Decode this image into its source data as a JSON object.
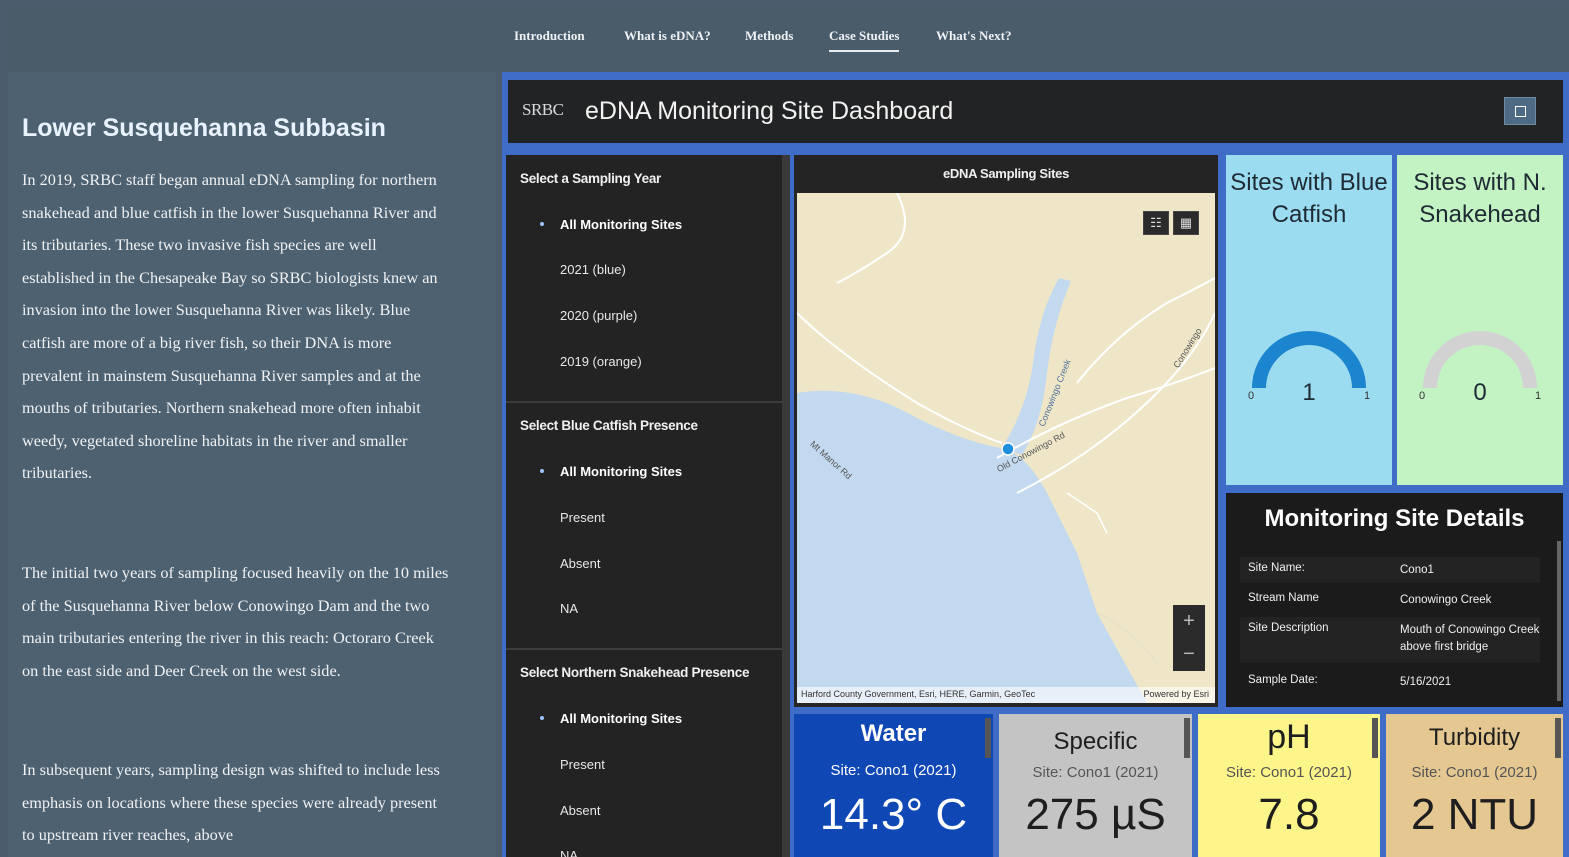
{
  "nav": {
    "items": [
      "Introduction",
      "What is eDNA?",
      "Methods",
      "Case Studies",
      "What's Next?"
    ],
    "active": "Case Studies"
  },
  "story": {
    "heading": "Lower Susquehanna Subbasin",
    "paragraphs": [
      "In 2019, SRBC staff began annual eDNA sampling for northern snakehead and blue catfish in the lower Susquehanna River and its tributaries. These two invasive fish species are well established in the Chesapeake Bay so SRBC biologists knew an invasion into the lower Susquehanna River was likely. Blue catfish are more of a big river fish, so their DNA is more prevalent in mainstem Susquehanna River samples and at the mouths of tributaries. Northern snakehead more often inhabit weedy, vegetated shoreline habitats in the river and smaller tributaries.",
      "The initial two years of sampling focused heavily on the 10 miles of the Susquehanna River below Conowingo Dam and the two main tributaries entering the river in this reach: Octoraro Creek on the east side and Deer Creek on the west side.",
      "In subsequent years, sampling design was shifted to include less emphasis on locations where these species were already present to upstream river reaches, above"
    ]
  },
  "dashboard": {
    "logo": "SRBC",
    "title": "eDNA Monitoring Site Dashboard",
    "filters": {
      "year": {
        "title": "Select a Sampling Year",
        "options": [
          "All Monitoring Sites",
          "2021 (blue)",
          "2020 (purple)",
          "2019 (orange)"
        ]
      },
      "catfish": {
        "title": "Select Blue Catfish Presence",
        "options": [
          "All Monitoring Sites",
          "Present",
          "Absent",
          "NA"
        ]
      },
      "snakehead": {
        "title": "Select Northern Snakehead Presence",
        "options": [
          "All Monitoring Sites",
          "Present",
          "Absent",
          "NA"
        ]
      }
    },
    "map": {
      "title": "eDNA Sampling Sites",
      "labels": {
        "creek": "Conowingo Creek",
        "road1": "Old Conowingo Rd",
        "road2": "Conowingo",
        "road3": "Mt Manor Rd"
      },
      "attribution": "Harford County Government, Esri, HERE, Garmin, GeoTec",
      "powered": "Powered by Esri",
      "zoom_in": "+",
      "zoom_out": "−",
      "colors": {
        "water": "#c3d9ef",
        "land": "#efe6c8",
        "site_point": "#1f8fe0"
      }
    },
    "gauges": [
      {
        "title": "Sites with Blue Catfish",
        "value": 1,
        "min": 0,
        "max": 1,
        "fill_fraction": 1,
        "bg": "#9bdcf1",
        "color": "#1b86cf"
      },
      {
        "title": "Sites with N. Snakehead",
        "value": 0,
        "min": 0,
        "max": 1,
        "fill_fraction": 0,
        "bg": "#c3f3c3",
        "color": "#d2d2d2"
      }
    ],
    "details": {
      "title": "Monitoring Site Details",
      "rows": [
        {
          "label": "Site Name:",
          "value": "Cono1"
        },
        {
          "label": "Stream Name",
          "value": "Conowingo Creek"
        },
        {
          "label": "Site Description",
          "value": "Mouth of Conowingo Creek above first bridge"
        },
        {
          "label": "Sample Date:",
          "value": "5/16/2021"
        }
      ]
    },
    "stats": [
      {
        "title": "Water",
        "site": "Site: Cono1 (2021)",
        "value": "14.3° C",
        "bg": "#0f47b5",
        "fg": "#ffffff"
      },
      {
        "title": "Specific",
        "site": "Site: Cono1 (2021)",
        "value": "275 µS",
        "bg": "#c4c4c4",
        "fg": "#1e1e1e"
      },
      {
        "title": "pH",
        "site": "Site: Cono1 (2021)",
        "value": "7.8",
        "bg": "#fbf58a",
        "fg": "#1e1e1e"
      },
      {
        "title": "Turbidity",
        "site": "Site: Cono1 (2021)",
        "value": "2 NTU",
        "bg": "#e5c891",
        "fg": "#1e1e1e"
      }
    ]
  }
}
